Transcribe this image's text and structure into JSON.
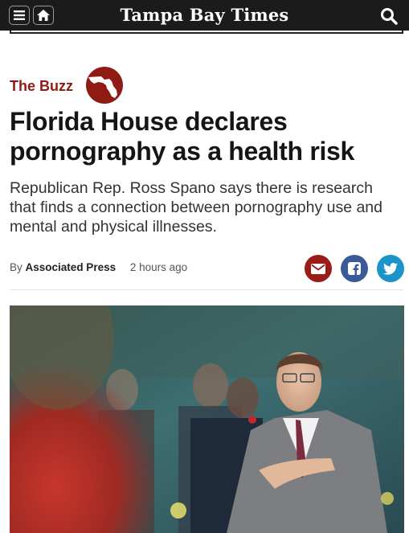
{
  "header": {
    "brand": "Tampa Bay Times",
    "icons": [
      "menu-icon",
      "home-icon",
      "search-icon"
    ],
    "background_color": "#1b1b1b"
  },
  "article": {
    "section": "The Buzz",
    "section_color": "#8f1b14",
    "section_logo": "florida-map-logo",
    "headline": "Florida House declares pornography as a health risk",
    "dek": "Republican Rep. Ross Spano says there is research that finds a connection between pornography use and mental and physical illnesses.",
    "byline": {
      "prefix": "By",
      "author": "Associated Press",
      "time": "2 hours ago"
    },
    "share": [
      {
        "name": "email",
        "icon": "envelope-icon",
        "color": "#9b1b17"
      },
      {
        "name": "facebook",
        "icon": "facebook-icon",
        "color": "#3b5b98"
      },
      {
        "name": "twitter",
        "icon": "twitter-bird-icon",
        "color": "#1b95c9"
      }
    ],
    "photo": {
      "subject": "man in gray suit with hand over heart"
    }
  }
}
